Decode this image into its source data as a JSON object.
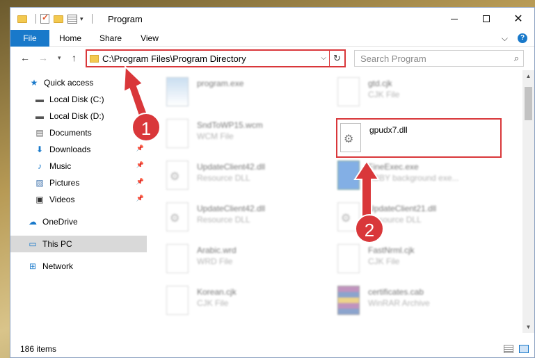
{
  "window": {
    "title": "Program",
    "buttons": {
      "minimize": "–",
      "maximize": "□",
      "close": "✕"
    }
  },
  "ribbon": {
    "tabs": [
      "File",
      "Home",
      "Share",
      "View"
    ],
    "help_chevron": "⌵",
    "help_icon": "?"
  },
  "nav": {
    "back": "←",
    "forward": "→",
    "recent": "▾",
    "up": "↑",
    "address": "C:\\Program Files\\Program Directory",
    "address_dropdown": "⌵",
    "refresh": "↻",
    "search_placeholder": "Search Program",
    "search_icon": "⌕"
  },
  "sidebar": {
    "items": [
      {
        "label": "Quick access",
        "icon": "star-icon"
      },
      {
        "label": "Local Disk (C:)",
        "icon": "drive-icon"
      },
      {
        "label": "Local Disk (D:)",
        "icon": "drive-icon"
      },
      {
        "label": "Documents",
        "icon": "documents-icon"
      },
      {
        "label": "Downloads",
        "icon": "download-icon",
        "pinned": true
      },
      {
        "label": "Music",
        "icon": "music-icon",
        "pinned": true
      },
      {
        "label": "Pictures",
        "icon": "pictures-icon",
        "pinned": true
      },
      {
        "label": "Videos",
        "icon": "videos-icon",
        "pinned": true
      },
      {
        "label": "OneDrive",
        "icon": "cloud-icon"
      },
      {
        "label": "This PC",
        "icon": "computer-icon",
        "selected": true
      },
      {
        "label": "Network",
        "icon": "network-icon"
      }
    ]
  },
  "files": [
    {
      "name": "program.exe",
      "type": ""
    },
    {
      "name": "gtd.cjk",
      "type": "CJK File"
    },
    {
      "name": "SndToWP15.wcm",
      "type": "WCM File"
    },
    {
      "name": "UpdateClient42.dll",
      "type": "Resource DLL"
    },
    {
      "name": "FineExec.exe",
      "type": "ABBY background exe..."
    },
    {
      "name": "UpdateClient42.dll",
      "type": "Resource DLL"
    },
    {
      "name": "UpdateClient21.dll",
      "type": "Resource DLL"
    },
    {
      "name": "Arabic.wrd",
      "type": "WRD File"
    },
    {
      "name": "FastNrml.cjk",
      "type": "CJK File"
    },
    {
      "name": "Korean.cjk",
      "type": "CJK File"
    },
    {
      "name": "certificates.cab",
      "type": "WinRAR Archive"
    }
  ],
  "highlighted_file": {
    "name": "gpudx7.dll"
  },
  "status": {
    "count": "186 items"
  },
  "annotations": {
    "badge1": "1",
    "badge2": "2"
  },
  "colors": {
    "accent": "#1979ca",
    "highlight": "#d9373a",
    "selected_bg": "#d9d9d9"
  }
}
